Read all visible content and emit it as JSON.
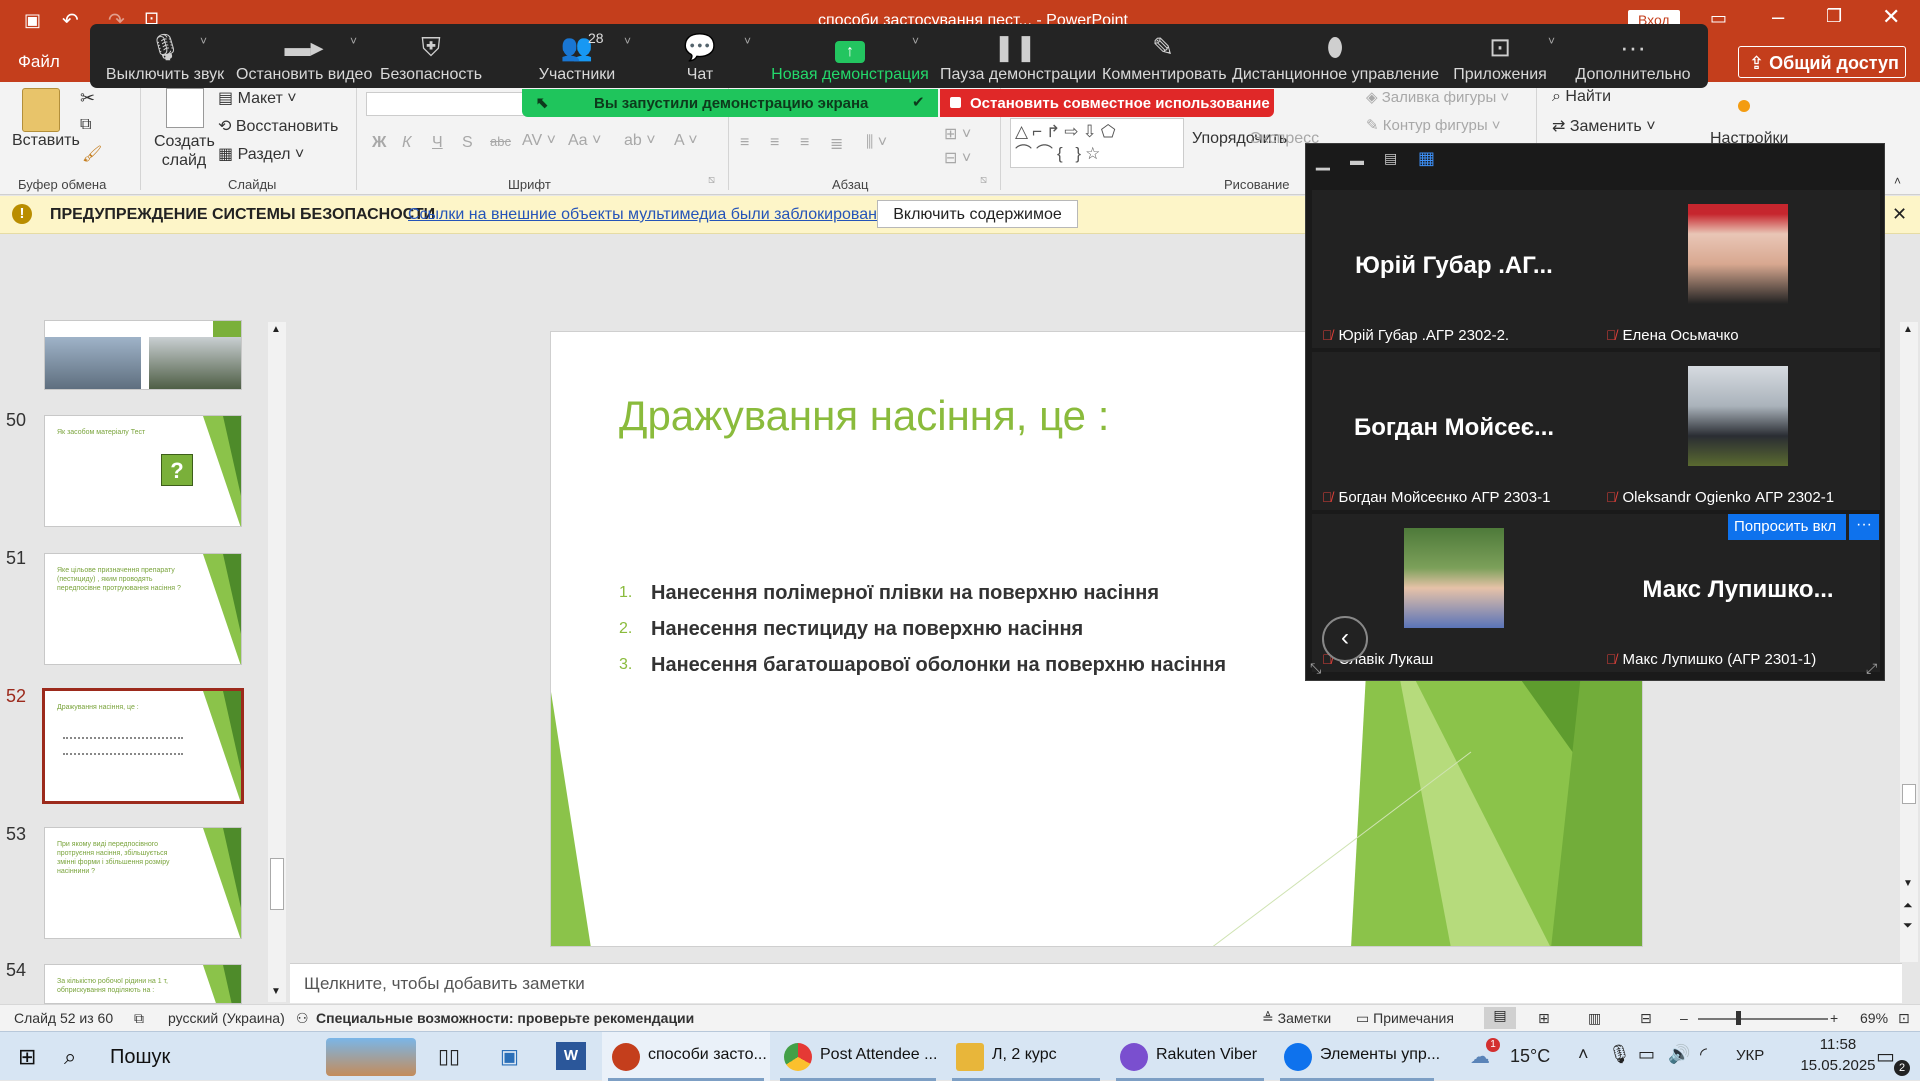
{
  "window": {
    "title": "способи застосування пест... - PowerPoint",
    "signin": "Вход"
  },
  "tabs": {
    "file": "Файл",
    "share": "Общий доступ"
  },
  "ribbon": {
    "paste": "Вставить",
    "create_slide": "Создать слайд",
    "layout": "Макет",
    "reset": "Восстановить",
    "section": "Раздел",
    "find": "Найти",
    "replace": "Заменить",
    "arrange": "Упорядочить",
    "express": "Экспресс",
    "settings": "Настройки",
    "shape_fill": "Заливка фигуры",
    "shape_outline": "Контур фигуры",
    "groups": {
      "clipboard": "Буфер обмена",
      "slides": "Слайды",
      "font": "Шрифт",
      "paragraph": "Абзац",
      "drawing": "Рисование"
    }
  },
  "zoom_toolbar": {
    "participants_count": "28",
    "buttons": [
      {
        "label": "Выключить звук",
        "icon": "mic-icon"
      },
      {
        "label": "Остановить видео",
        "icon": "video-camera-icon"
      },
      {
        "label": "Безопасность",
        "icon": "shield-icon"
      },
      {
        "label": "Участники",
        "icon": "participants-icon"
      },
      {
        "label": "Чат",
        "icon": "chat-icon"
      },
      {
        "label": "Новая демонстрация",
        "icon": "share-screen-icon"
      },
      {
        "label": "Пауза демонстрации",
        "icon": "pause-icon"
      },
      {
        "label": "Комментировать",
        "icon": "pen-icon"
      },
      {
        "label": "Дистанционное управление",
        "icon": "mouse-icon"
      },
      {
        "label": "Приложения",
        "icon": "apps-icon"
      },
      {
        "label": "Дополнительно",
        "icon": "more-icon"
      }
    ],
    "share_banner": "Вы запустили демонстрацию экрана",
    "stop_share": "Остановить совместное использование"
  },
  "security": {
    "title": "ПРЕДУПРЕЖДЕНИЕ СИСТЕМЫ БЕЗОПАСНОСТИ",
    "message": "Ссылки на внешние объекты мультимедиа были заблокированы",
    "button": "Включить содержимое"
  },
  "thumbnails": [
    {
      "num": "50",
      "text": "Як засобом матеріалу Тест"
    },
    {
      "num": "51",
      "text": "Яке цільове призначення препарату (пестициду) , яким проводять передпосівне протруювання насіння ?"
    },
    {
      "num": "52",
      "text": "Дражування насіння, це :"
    },
    {
      "num": "53",
      "text": "При якому виді передпосівного протруєння насіння, збільшується змінні форми і збільшення розміру насіннини ?"
    },
    {
      "num": "54",
      "text": "За кількістю робочої рідини на 1 т, обприскування поділяють на :"
    }
  ],
  "slide": {
    "title": "Дражування насіння,  це :",
    "items": [
      {
        "n": "1.",
        "text": "Нанесення полімерної плівки на поверхню  насіння"
      },
      {
        "n": "2.",
        "text": "Нанесення пестициду на поверхню насіння"
      },
      {
        "n": "3.",
        "text": "Нанесення багатошарової оболонки на поверхню насіння"
      }
    ]
  },
  "notes_placeholder": "Щелкните, чтобы добавить заметки",
  "gallery": {
    "tiles": [
      {
        "big": "Юрій Губар .АГ...",
        "name": "Юрій Губар .АГР 2302-2."
      },
      {
        "big": "",
        "name": "Елена Осьмачко"
      },
      {
        "big": "Богдан  Мойсеє...",
        "name": "Богдан Мойсеєнко АГР 2303-1"
      },
      {
        "big": "",
        "name": "Oleksandr Ogienko АГР 2302-1"
      },
      {
        "big": "",
        "name": "Славік Лукаш"
      },
      {
        "big": "Макс Лупишко...",
        "name": "Макс Лупишко (АГР 2301-1)"
      }
    ],
    "ask_button": "Попросить вкл",
    "more_button": "···"
  },
  "status": {
    "slide_info": "Слайд 52 из 60",
    "language": "русский (Украина)",
    "accessibility": "Специальные возможности: проверьте рекомендации",
    "notes": "Заметки",
    "comments": "Примечания",
    "zoom": "69%"
  },
  "taskbar": {
    "search": "Пошук",
    "items": [
      {
        "label": "способи засто...",
        "color": "#c43e1c"
      },
      {
        "label": "Post Attendee ...",
        "color": "#2a7ae4"
      },
      {
        "label": "Л, 2 курс",
        "color": "#e8b63a"
      },
      {
        "label": "Rakuten Viber",
        "color": "#7a4fcf"
      },
      {
        "label": "Элементы упр...",
        "color": "#0e72ed"
      }
    ],
    "temperature": "15°C",
    "lang": "УКР",
    "time": "11:58",
    "date": "15.05.2025",
    "notif_badge": "1",
    "chat_badge": "2"
  }
}
